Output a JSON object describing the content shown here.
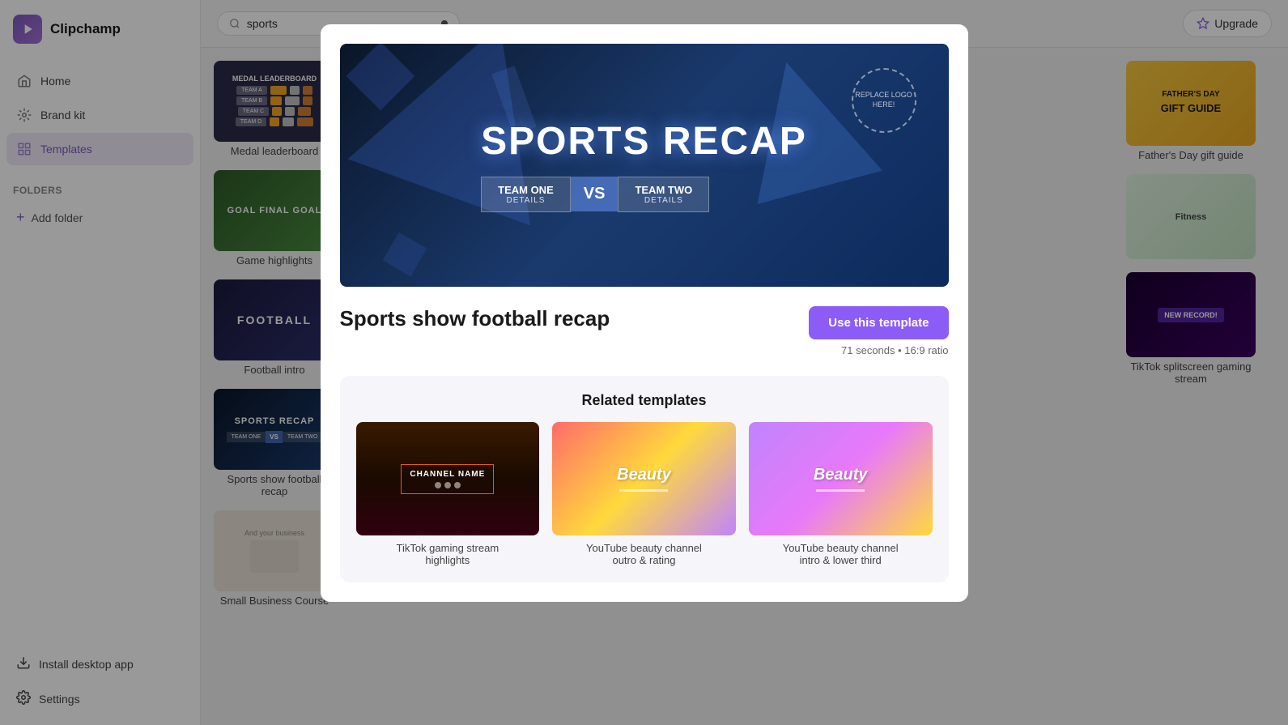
{
  "app": {
    "name": "Clipchamp"
  },
  "topbar": {
    "search_placeholder": "sports",
    "search_value": "sports",
    "upgrade_label": "Upgrade"
  },
  "sidebar": {
    "nav_items": [
      {
        "id": "home",
        "label": "Home"
      },
      {
        "id": "brand",
        "label": "Brand kit"
      },
      {
        "id": "templates",
        "label": "Templates"
      }
    ],
    "folders_title": "FOLDERS",
    "add_folder_label": "Add folder",
    "bottom_items": [
      {
        "id": "install",
        "label": "Install desktop app"
      },
      {
        "id": "settings",
        "label": "Settings"
      }
    ]
  },
  "templates_grid": {
    "items": [
      {
        "id": "medal",
        "label": "Medal leaderboard"
      },
      {
        "id": "game-highlights",
        "label": "Game highlights"
      },
      {
        "id": "football-intro",
        "label": "Football intro"
      },
      {
        "id": "sports-recap",
        "label": "Sports show football recap"
      },
      {
        "id": "small-biz",
        "label": "Small Business Course"
      }
    ]
  },
  "right_grid": {
    "items": [
      {
        "id": "fathers-day",
        "label": "Father's Day gift guide"
      },
      {
        "id": "tiktok-gaming",
        "label": "TikTok splitscreen gaming stream"
      }
    ]
  },
  "modal": {
    "title": "Sports show football recap",
    "preview_title": "SPORTS RECAP",
    "preview_logo_text": "REPLACE\nLOGO HERE!",
    "team_one_name": "TEAM ONE",
    "team_one_detail": "DETAILS",
    "team_two_name": "TEAM TWO",
    "team_two_detail": "DETAILS",
    "vs_text": "VS",
    "use_template_label": "Use this template",
    "meta": "71 seconds • 16:9 ratio",
    "related_title": "Related templates",
    "related_items": [
      {
        "id": "tiktok-gaming-stream",
        "label": "TikTok gaming stream\nhighlights",
        "channel_text": "CHANNEL NAME"
      },
      {
        "id": "yt-beauty-outro",
        "label": "YouTube beauty channel\noutro & rating",
        "beauty_text": "Beauty"
      },
      {
        "id": "yt-beauty-intro",
        "label": "YouTube beauty channel\nintro & lower third",
        "beauty_text": "Beauty"
      }
    ]
  }
}
